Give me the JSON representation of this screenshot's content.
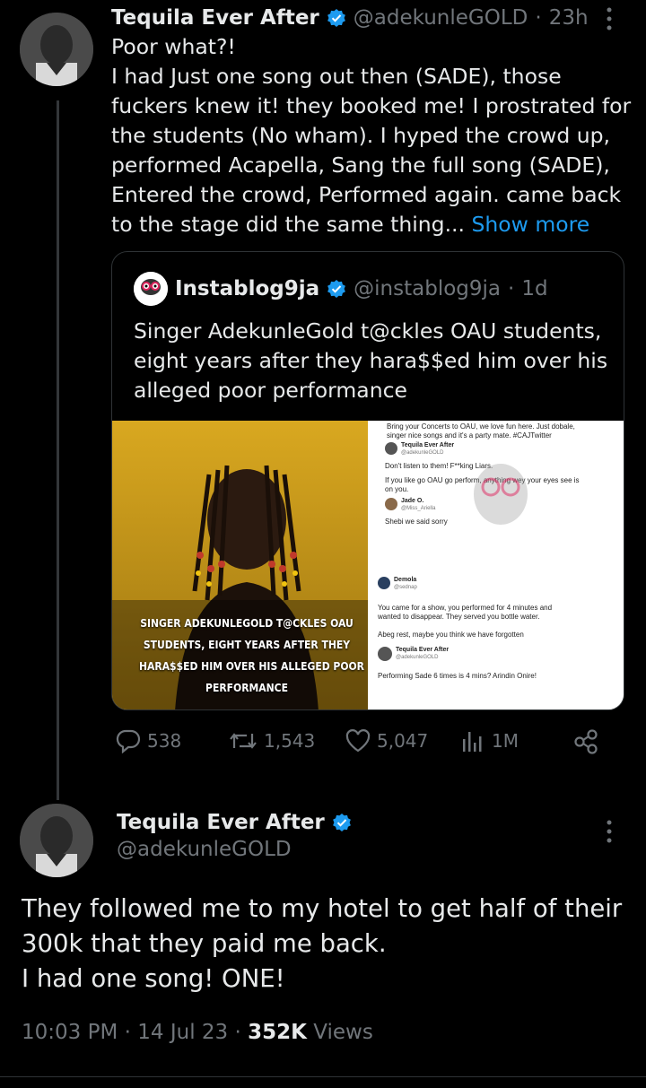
{
  "tweet1": {
    "name": "Tequila Ever After",
    "handle": "@adekunleGOLD",
    "time": "23h",
    "lines": [
      "Poor what?!",
      "I had Just one song out then (SADE), those",
      "fuckers knew it! they booked me! I prostrated for",
      "the students (No wham). I hyped the crowd up,",
      "performed Acapella, Sang the full song (SADE),",
      "Entered the crowd, Performed again. came back",
      "to the stage did the same thing..."
    ],
    "show_more": "Show more"
  },
  "quote": {
    "name": "Instablog9ja",
    "handle": "@instablog9ja",
    "time": "1d",
    "logo_text": "instablog9ja",
    "lines": [
      "Singer AdekunleGold t@ckles OAU students,",
      "eight years after they hara$$ed him over his",
      "alleged poor performance"
    ],
    "caption_lines": [
      "SINGER ADEKUNLEGOLD T@CKLES OAU",
      "STUDENTS, EIGHT YEARS AFTER THEY",
      "HARA$$ED HIM OVER HIS ALLEGED POOR",
      "PERFORMANCE"
    ],
    "screenshot_top": {
      "line1": "Bring your Concerts to OAU, we love fun here. Just dobale,",
      "line2": "singer nice songs and it's a party mate. #CAJTwitter",
      "reply_name": "Tequila Ever After",
      "reply_handle": "@adekunleGOLD",
      "reply_text1": "Don't listen to them! F**king Liars.",
      "reply_text2": "If you like go OAU go perform, anything wey your eyes see is",
      "reply_text3": "on you.",
      "reply2_name": "Jade O.",
      "reply2_handle": "@Miss_Ariella",
      "reply2_text": "Shebi we said sorry"
    },
    "screenshot_bottom": {
      "name": "Demola",
      "handle": "@sednap",
      "text1": "You came for a show, you performed for 4 minutes and",
      "text2": "wanted to disappear. They served you bottle water.",
      "text3": "Abeg rest, maybe you think we have forgotten",
      "reply_name": "Tequila Ever After",
      "reply_handle": "@adekunleGOLD",
      "reply_text": "Performing Sade 6 times is 4 mins? Arindin Onire!"
    }
  },
  "actions": {
    "replies": "538",
    "retweets": "1,543",
    "likes": "5,047",
    "views": "1M"
  },
  "tweet2": {
    "name": "Tequila Ever After",
    "handle": "@adekunleGOLD",
    "lines": [
      "They followed me to my hotel to get half of their",
      "300k that they paid me back.",
      "I had one song! ONE!"
    ],
    "time": "10:03 PM",
    "date": "14 Jul 23",
    "views_count": "352K",
    "views_label": "Views"
  },
  "colors": {
    "background": "#000000",
    "text": "#e7e9ea",
    "muted": "#71767b",
    "link": "#1d9bf0",
    "verified": "#1d9bf0"
  }
}
